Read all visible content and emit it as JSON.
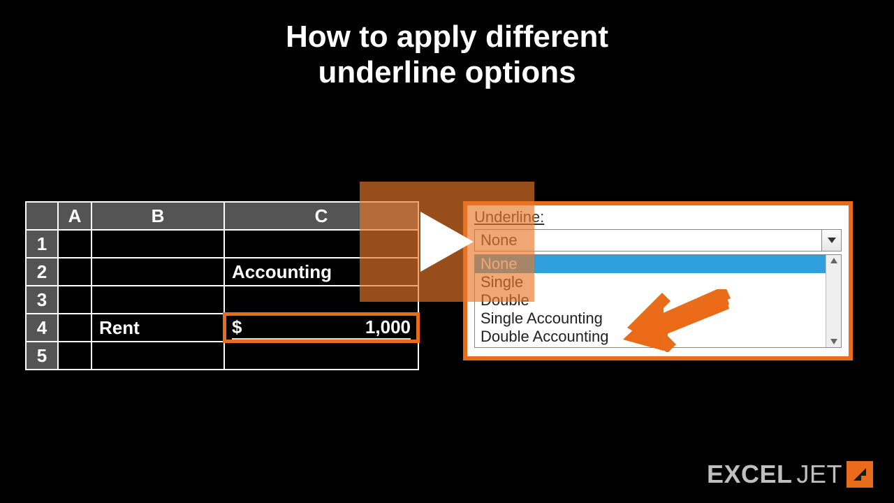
{
  "title_line1": "How to apply different",
  "title_line2": "underline options",
  "sheet": {
    "columns": [
      "A",
      "B",
      "C"
    ],
    "rows": [
      "1",
      "2",
      "3",
      "4",
      "5"
    ],
    "c2": "Accounting",
    "b4": "Rent",
    "c4_currency": "$",
    "c4_value": "1,000"
  },
  "dropdown": {
    "label": "Underline:",
    "selected": "None",
    "options": [
      "None",
      "Single",
      "Double",
      "Single Accounting",
      "Double Accounting"
    ],
    "highlighted_index": 0
  },
  "logo": {
    "part1": "EXCEL",
    "part2": "JET"
  }
}
